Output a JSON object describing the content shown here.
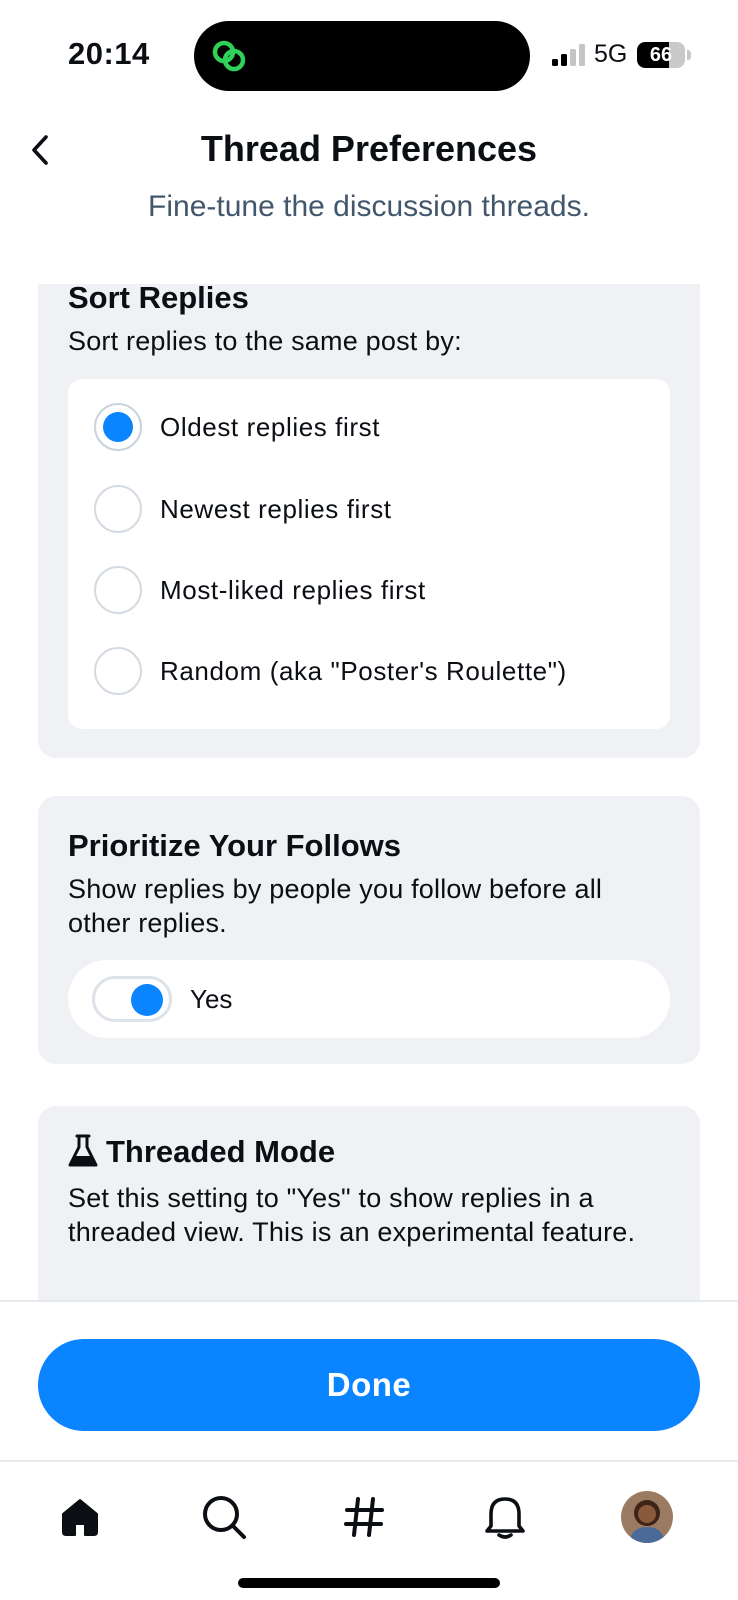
{
  "status_bar": {
    "time": "20:14",
    "network": "5G",
    "battery_level": "66",
    "battery_fraction": 0.66,
    "icons": [
      "threads-app-icon",
      "signal-icon",
      "battery-icon"
    ]
  },
  "header": {
    "title": "Thread Preferences",
    "subtitle": "Fine-tune the discussion threads.",
    "back_icon": "chevron-left-icon"
  },
  "sort_replies": {
    "title": "Sort Replies",
    "description": "Sort replies to the same post by:",
    "options": [
      {
        "label": "Oldest replies first",
        "selected": true
      },
      {
        "label": "Newest replies first",
        "selected": false
      },
      {
        "label": "Most-liked replies first",
        "selected": false
      },
      {
        "label": "Random (aka \"Poster's Roulette\")",
        "selected": false
      }
    ]
  },
  "prioritize_follows": {
    "title": "Prioritize Your Follows",
    "description": "Show replies by people you follow before all other replies.",
    "toggle_label": "Yes",
    "toggle_on": true
  },
  "threaded_mode": {
    "icon": "flask-icon",
    "title": "Threaded Mode",
    "description": "Set this setting to \"Yes\" to show replies in a threaded view. This is an experimental feature."
  },
  "footer": {
    "done_label": "Done"
  },
  "tab_bar": {
    "items": [
      "home-icon",
      "search-icon",
      "hashtag-icon",
      "notifications-icon",
      "profile-avatar"
    ]
  },
  "colors": {
    "accent": "#0a84ff",
    "card_background": "#eff1f4",
    "subtitle_text": "#42576c"
  }
}
